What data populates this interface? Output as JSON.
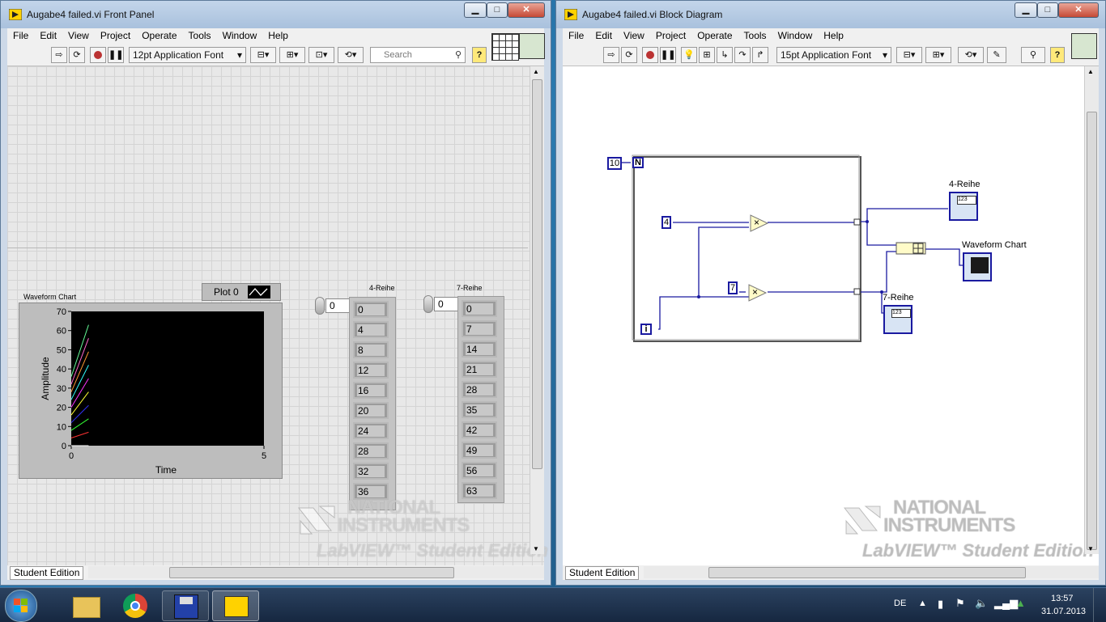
{
  "front_panel": {
    "title": "Augabe4 failed.vi Front Panel",
    "menu": [
      "File",
      "Edit",
      "View",
      "Project",
      "Operate",
      "Tools",
      "Window",
      "Help"
    ],
    "font_selector": "12pt Application Font",
    "search_placeholder": "Search",
    "status": "Student Edition",
    "plot_legend": "Plot 0",
    "chart": {
      "label": "Waveform Chart",
      "xlabel": "Time",
      "ylabel": "Amplitude",
      "y_ticks": [
        "70",
        "60",
        "50",
        "40",
        "30",
        "20",
        "10",
        "0"
      ],
      "x_ticks": [
        "0",
        "5"
      ]
    },
    "array4": {
      "label": "4-Reihe",
      "index": "0",
      "values": [
        "0",
        "4",
        "8",
        "12",
        "16",
        "20",
        "24",
        "28",
        "32",
        "36"
      ]
    },
    "array7": {
      "label": "7-Reihe",
      "index": "0",
      "values": [
        "0",
        "7",
        "14",
        "21",
        "28",
        "35",
        "42",
        "49",
        "56",
        "63"
      ]
    }
  },
  "block_diagram": {
    "title": "Augabe4 failed.vi Block Diagram",
    "menu": [
      "File",
      "Edit",
      "View",
      "Project",
      "Operate",
      "Tools",
      "Window",
      "Help"
    ],
    "font_selector": "15pt Application Font",
    "status": "Student Edition",
    "loop_count_const": "10",
    "loop_n": "N",
    "loop_i": "i",
    "const4": "4",
    "const7": "7",
    "mult_symbol": "×",
    "ind4_label": "4-Reihe",
    "ind7_label": "7-Reihe",
    "chart_label": "Waveform Chart"
  },
  "watermark": {
    "line1": "NATIONAL",
    "line2": "INSTRUMENTS",
    "line3": "LabVIEW™ Student Edition"
  },
  "window_buttons": {
    "min": "▁",
    "max": "□",
    "close": "✕"
  },
  "taskbar": {
    "lang": "DE",
    "time": "13:57",
    "date": "31.07.2013"
  },
  "chart_data": {
    "type": "line",
    "xlabel": "Time",
    "ylabel": "Amplitude",
    "ylim": [
      0,
      70
    ],
    "xlim": [
      0,
      5
    ],
    "x": [
      0,
      1
    ],
    "series": [
      {
        "values": [
          0,
          0
        ],
        "color": "#ffffff"
      },
      {
        "values": [
          4,
          7
        ],
        "color": "#ff3333"
      },
      {
        "values": [
          8,
          14
        ],
        "color": "#33ff33"
      },
      {
        "values": [
          12,
          21
        ],
        "color": "#3333ff"
      },
      {
        "values": [
          16,
          28
        ],
        "color": "#ffff33"
      },
      {
        "values": [
          20,
          35
        ],
        "color": "#ff33ff"
      },
      {
        "values": [
          24,
          42
        ],
        "color": "#33ffff"
      },
      {
        "values": [
          28,
          49
        ],
        "color": "#ff9933"
      },
      {
        "values": [
          32,
          56
        ],
        "color": "#ff66cc"
      },
      {
        "values": [
          36,
          63
        ],
        "color": "#66ff99"
      }
    ],
    "grid": false
  },
  "colors": {
    "wire": "#1a1aa0",
    "chart_bg": "#000000",
    "panel_bg": "#e8e8e8"
  }
}
